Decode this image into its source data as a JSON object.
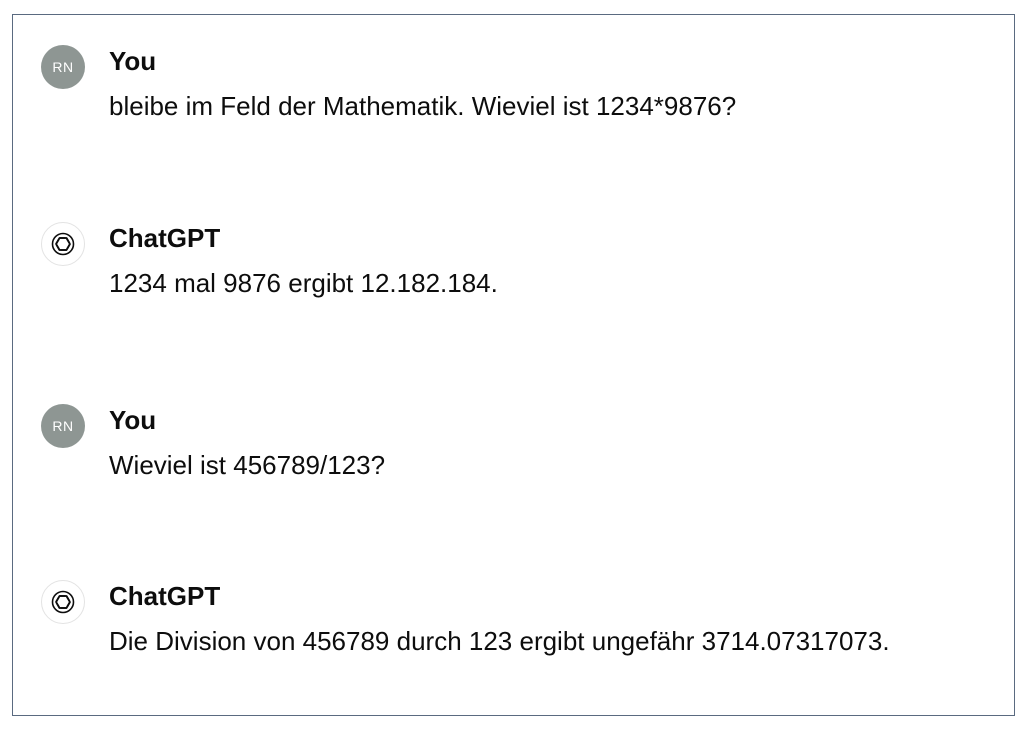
{
  "conversation": {
    "messages": [
      {
        "role": "user",
        "avatar_initials": "RN",
        "author": "You",
        "text": "bleibe im Feld der Mathematik. Wieviel ist 1234*9876?"
      },
      {
        "role": "assistant",
        "avatar_icon": "openai-logo-icon",
        "author": "ChatGPT",
        "text": "1234 mal 9876 ergibt 12.182.184."
      },
      {
        "role": "user",
        "avatar_initials": "RN",
        "author": "You",
        "text": "Wieviel ist 456789/123?"
      },
      {
        "role": "assistant",
        "avatar_icon": "openai-logo-icon",
        "author": "ChatGPT",
        "text": "Die Division von 456789 durch 123 ergibt ungefähr 3714.07317073."
      }
    ]
  },
  "colors": {
    "user_avatar_bg": "#8e9693",
    "frame_border": "#5a6a80",
    "text": "#0d0d0d"
  }
}
